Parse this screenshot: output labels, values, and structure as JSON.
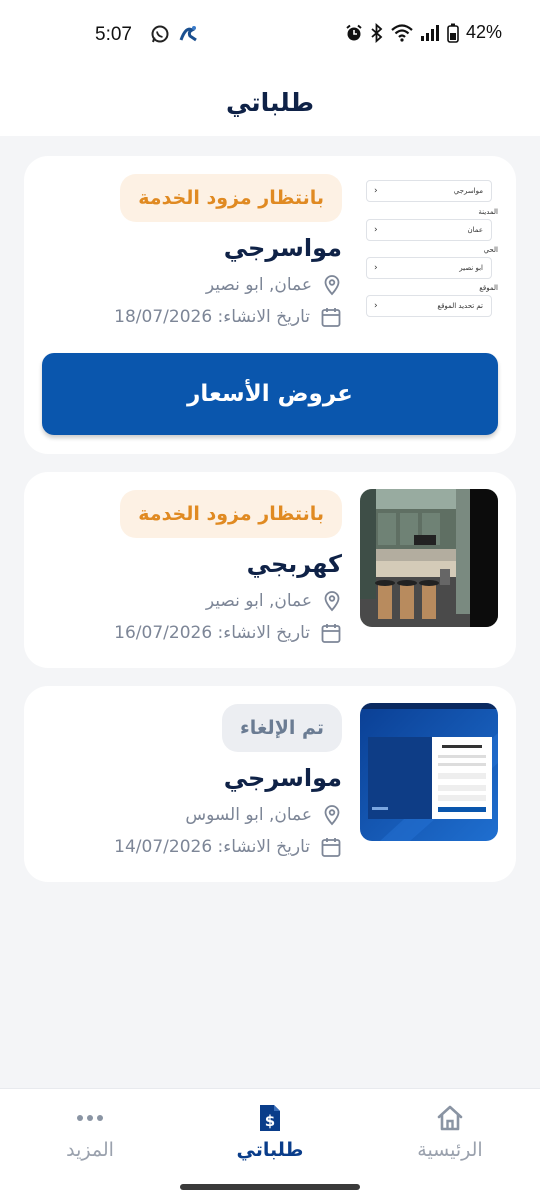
{
  "status_bar": {
    "time": "5:07",
    "battery": "42%"
  },
  "header": {
    "title": "طلباتي"
  },
  "orders": [
    {
      "status": "بانتظار مزود الخدمة",
      "service": "مواسرجي",
      "location": "عمان, ابو نصير",
      "created": "تاريخ الانشاء: 18/07/2026",
      "action_label": "عروض الأسعار",
      "thumb_form": {
        "field1": "مواسرجي",
        "label2": "المدينة",
        "field2": "عمان",
        "label3": "الحي",
        "field3": "ابو نصير",
        "label4": "الموقع",
        "field4": "تم تحديد الموقع"
      }
    },
    {
      "status": "بانتظار مزود الخدمة",
      "service": "كهربجي",
      "location": "عمان, ابو نصير",
      "created": "تاريخ الانشاء: 16/07/2026"
    },
    {
      "status": "تم الإلغاء",
      "service": "مواسرجي",
      "location": "عمان, ابو السوس",
      "created": "تاريخ الانشاء: 14/07/2026"
    }
  ],
  "nav": {
    "home": "الرئيسية",
    "orders": "طلباتي",
    "more": "المزيد"
  },
  "colors": {
    "primary": "#0a56ad",
    "pending": "#e08a22",
    "navy": "#0f2247"
  }
}
